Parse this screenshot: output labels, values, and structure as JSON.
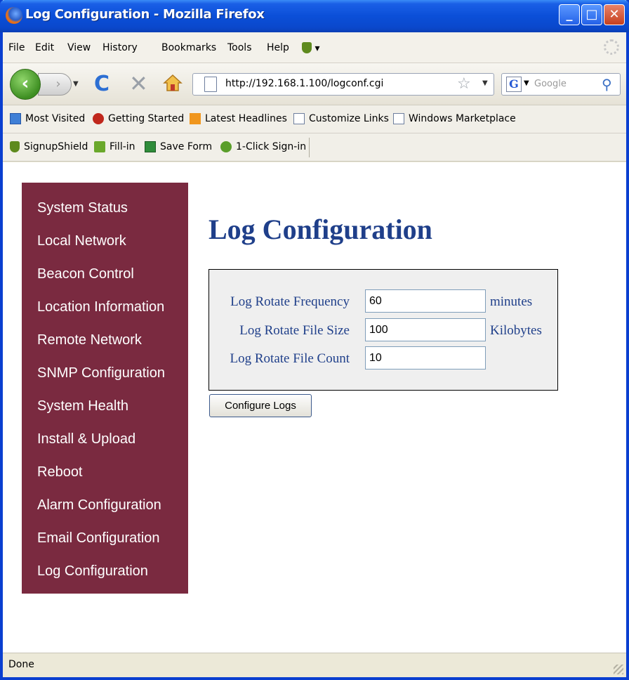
{
  "window": {
    "title": "Log Configuration - Mozilla Firefox"
  },
  "menu": [
    "File",
    "Edit",
    "View",
    "History",
    "Bookmarks",
    "Tools",
    "Help"
  ],
  "navigation": {
    "url": "http://192.168.1.100/logconf.cgi",
    "search_placeholder": "Google"
  },
  "bookmarks": [
    "Most Visited",
    "Getting Started",
    "Latest Headlines",
    "Customize Links",
    "Windows Marketplace"
  ],
  "addons": [
    "SignupShield",
    "Fill-in",
    "Save Form",
    "1-Click Sign-in"
  ],
  "sidebar": {
    "items": [
      "System Status",
      "Local Network",
      "Beacon Control",
      "Location Information",
      "Remote Network",
      "SNMP Configuration",
      "System Health",
      "Install & Upload",
      "Reboot",
      "Alarm Configuration",
      "Email Configuration",
      "Log Configuration"
    ]
  },
  "page": {
    "title": "Log Configuration",
    "fields": [
      {
        "label": "Log Rotate Frequency",
        "value": "60",
        "unit": "minutes"
      },
      {
        "label": "Log Rotate File Size",
        "value": "100",
        "unit": "Kilobytes"
      },
      {
        "label": "Log Rotate File Count",
        "value": "10",
        "unit": ""
      }
    ],
    "submit_label": "Configure Logs"
  },
  "status": {
    "text": "Done"
  },
  "colors": {
    "sidebar_bg": "#7a2a40",
    "heading": "#1f3f8a"
  }
}
